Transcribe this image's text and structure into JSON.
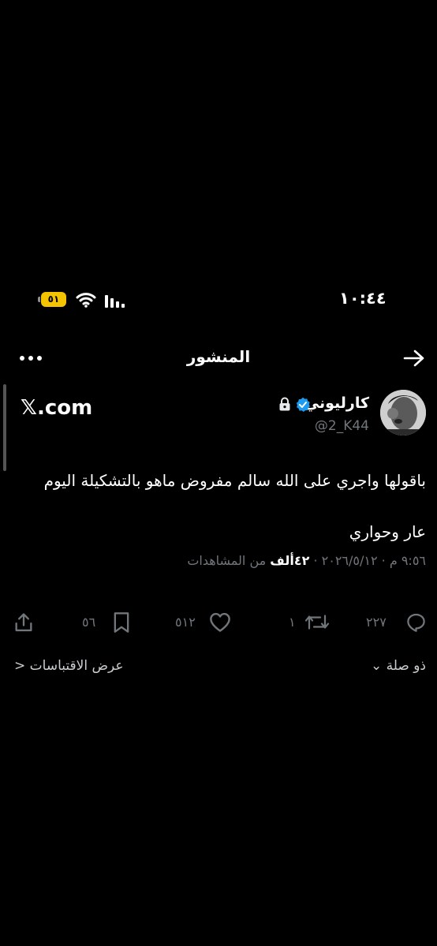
{
  "status_bar": {
    "time": "١٠:٤٤",
    "battery": "٥١"
  },
  "header": {
    "title": "المنشور"
  },
  "tweet": {
    "display_name": "كارليوني",
    "handle": "@2_K44",
    "source": "𝕏.com",
    "text_lines": [
      "باقولها واجري على الله سالم مفروض ماهو بالتشكيلة اليوم",
      "عار وحواري"
    ],
    "meta": {
      "datetime": "٩:٥٦ م · ٢٠٢٦/٥/١٢ · ",
      "views_count": "٤٢ألف",
      "views_label": " من المشاهدات"
    }
  },
  "actions": {
    "replies": "٢٢٧",
    "reposts": "١",
    "likes": "٥١٢",
    "bookmarks": "٥٦"
  },
  "footer": {
    "sort_label": "ذو صلة",
    "quotes_label": "عرض الاقتباسات"
  },
  "colors": {
    "background": "#000000",
    "verified": "#1d9bf0",
    "muted": "#71767b",
    "battery": "#f5c400"
  }
}
